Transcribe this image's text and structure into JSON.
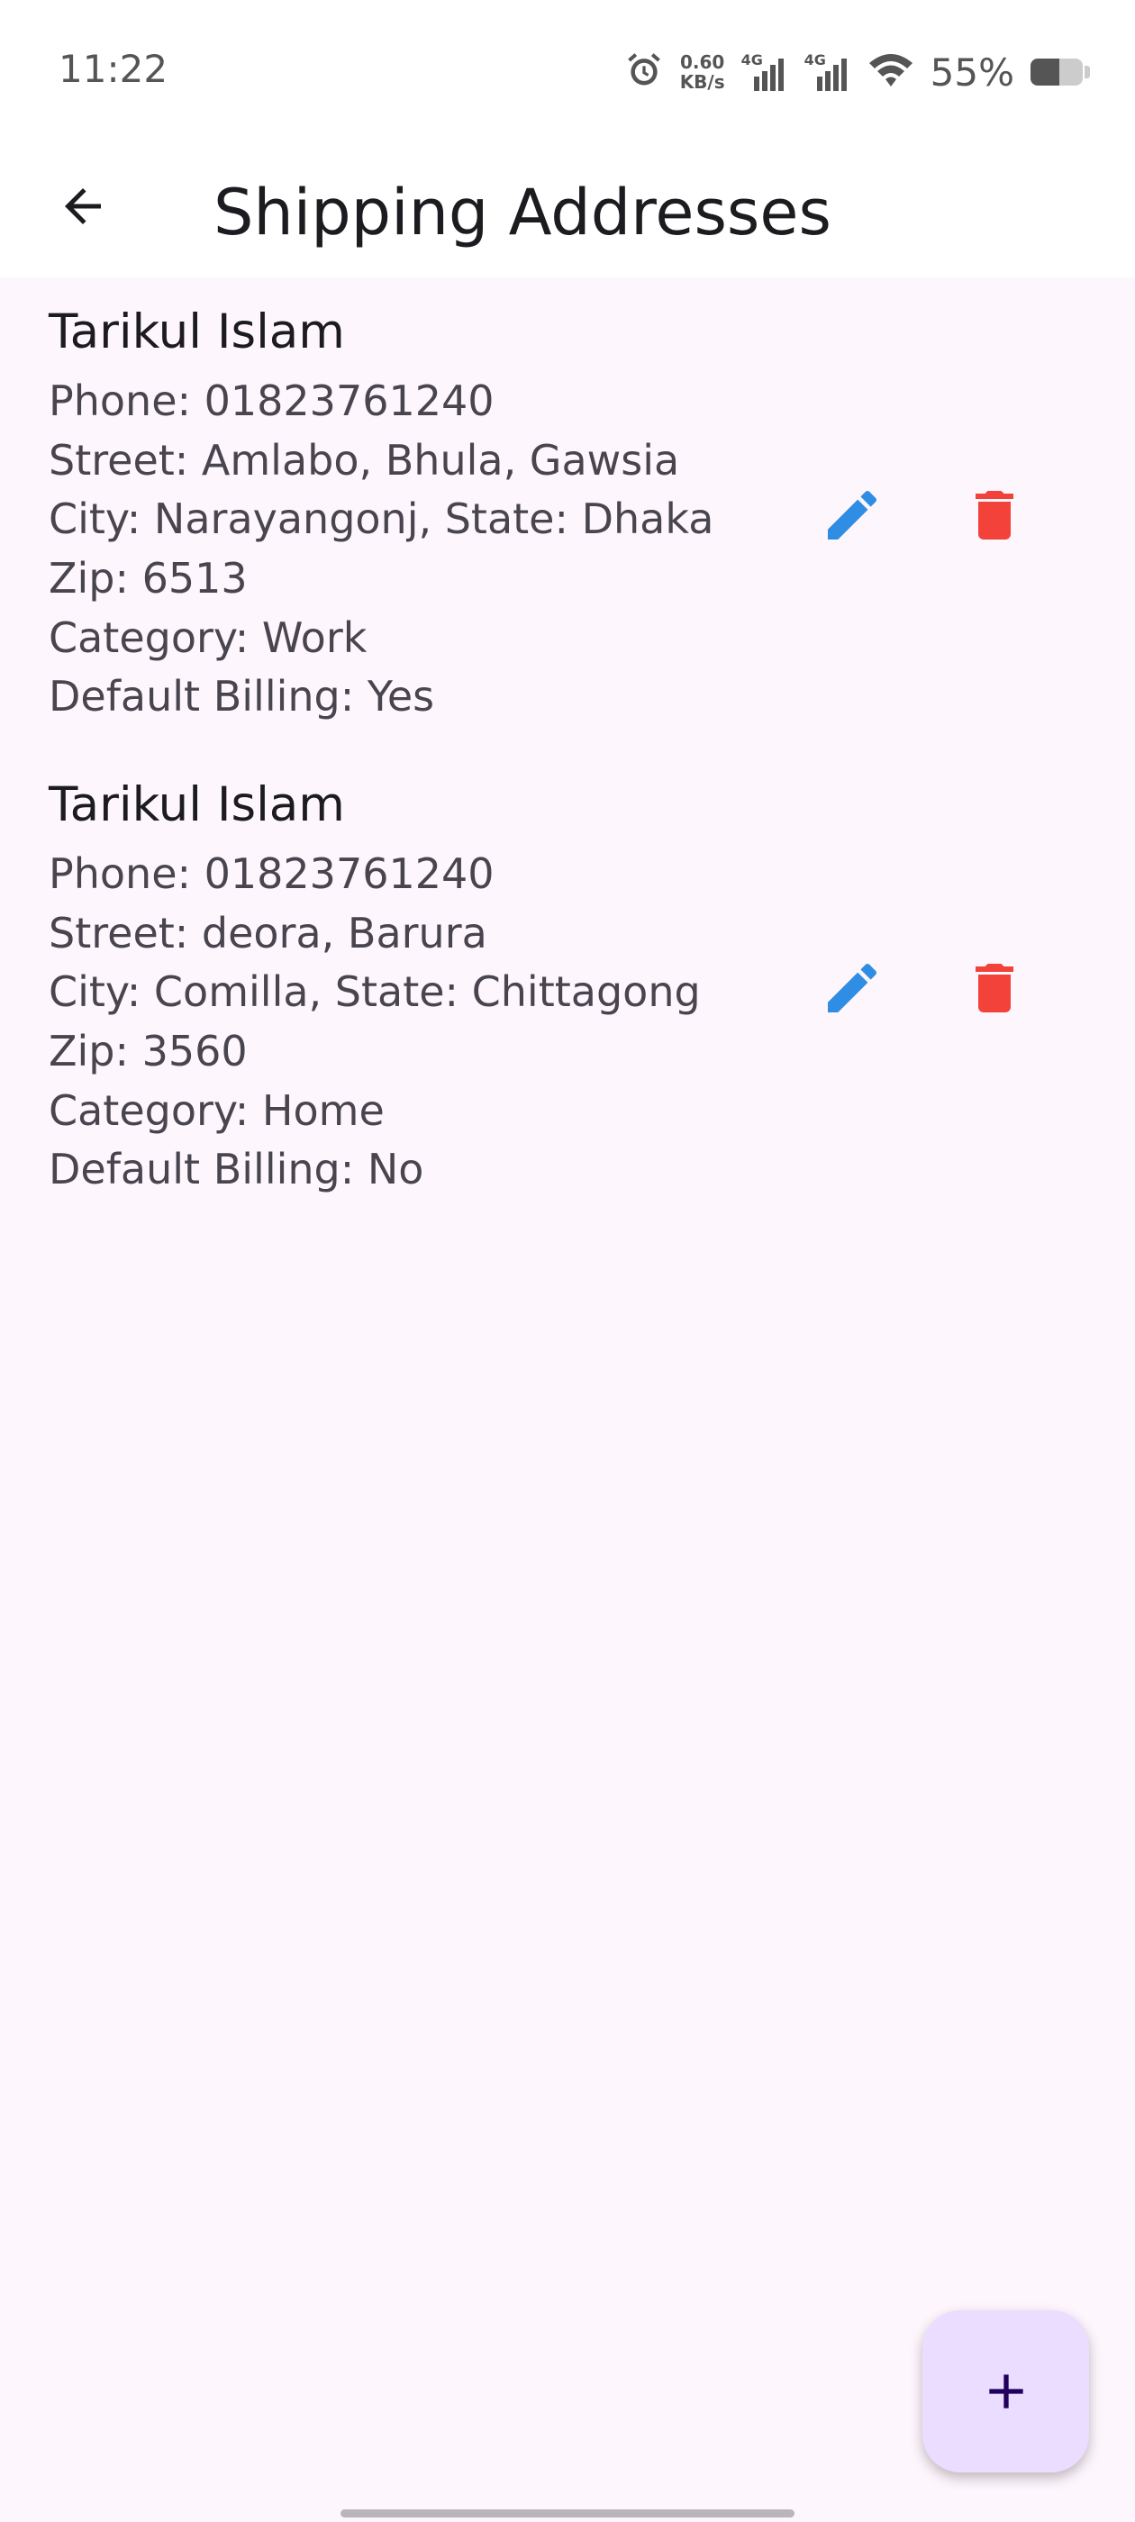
{
  "status_bar": {
    "time": "11:22",
    "net_speed_value": "0.60",
    "net_speed_unit": "KB/s",
    "network_tag_1": "4G",
    "network_tag_2": "4G",
    "battery_text": "55%",
    "battery_level": 0.55,
    "icons": [
      "alarm-icon",
      "signal-icon",
      "signal-icon",
      "wifi-icon",
      "battery-icon"
    ]
  },
  "app_bar": {
    "title": "Shipping Addresses",
    "back_icon": "arrow-left-icon"
  },
  "addresses": [
    {
      "name": "Tarikul Islam",
      "phone": "Phone: 01823761240",
      "street": "Street: Amlabo, Bhula, Gawsia",
      "city": "City: Narayangonj, State: Dhaka",
      "zip": "Zip: 6513",
      "category": "Category: Work",
      "default_billing": "Default Billing: Yes"
    },
    {
      "name": "Tarikul Islam",
      "phone": "Phone: 01823761240",
      "street": "Street: deora, Barura",
      "city": "City: Comilla, State: Chittagong",
      "zip": "Zip: 3560",
      "category": "Category: Home",
      "default_billing": "Default Billing: No"
    }
  ],
  "actions": {
    "edit_icon": "pencil-icon",
    "delete_icon": "trash-icon",
    "fab_icon": "plus-icon"
  },
  "colors": {
    "edit": "#2f8de4",
    "delete": "#f2423a",
    "fab_bg": "#eaddff",
    "background": "#fdf6fd"
  }
}
